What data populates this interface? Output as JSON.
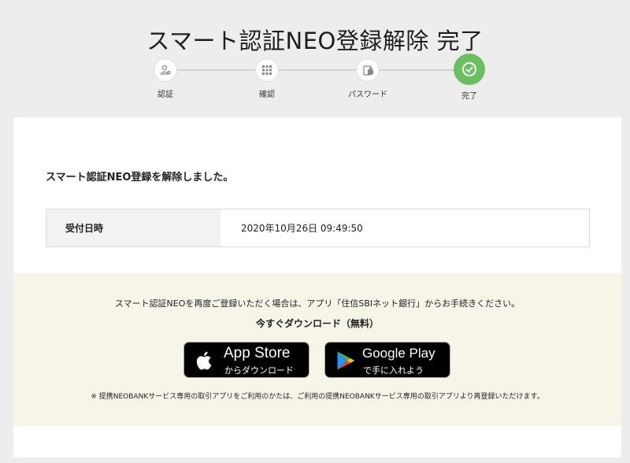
{
  "page_title": "スマート認証NEO登録解除 完了",
  "stepper": {
    "steps": [
      {
        "label": "認証",
        "icon": "person-key-icon"
      },
      {
        "label": "確認",
        "icon": "keypad-icon"
      },
      {
        "label": "パスワード",
        "icon": "password-lock-icon"
      },
      {
        "label": "完了",
        "icon": "check-icon"
      }
    ],
    "active_index": 3,
    "active_color": "#6abf5e"
  },
  "card": {
    "message": "スマート認証NEO登録を解除しました。",
    "table": {
      "header": "受付日時",
      "value": "2020年10月26日 09:49:50"
    }
  },
  "promo": {
    "text": "スマート認証NEOを再度ご登録いただく場合は、アプリ「住信SBIネット銀行」からお手続きください。",
    "heading": "今すぐダウンロード（無料）",
    "app_store": {
      "title": "App Store",
      "subtitle": "からダウンロード"
    },
    "google_play": {
      "title": "Google Play",
      "subtitle": "で手に入れよう"
    },
    "note": "※ 提携NEOBANKサービス専用の取引アプリをご利用のかたは、ご利用の提携NEOBANKサービス専用の取引アプリより再登録いただけます。"
  }
}
